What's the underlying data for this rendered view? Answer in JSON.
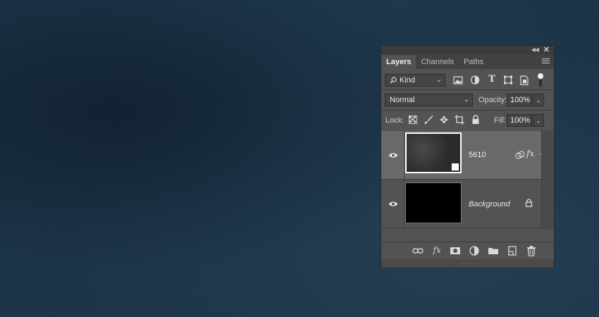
{
  "panel": {
    "tabs": [
      "Layers",
      "Channels",
      "Paths"
    ],
    "filter": {
      "value": "Kind"
    },
    "blend_mode": {
      "value": "Normal"
    },
    "opacity": {
      "label": "Opacity:",
      "value": "100%"
    },
    "lock": {
      "label": "Lock:"
    },
    "fill": {
      "label": "Fill:",
      "value": "100%"
    },
    "layers": [
      {
        "name": "5610",
        "visible": true,
        "selected": true,
        "thumbnail": "dark-texture",
        "smart_object": true,
        "effects": true
      },
      {
        "name": "Background",
        "visible": true,
        "selected": false,
        "thumbnail": "black",
        "locked": true
      }
    ],
    "bottom_icons": [
      "link-layers-icon",
      "fx-icon",
      "add-mask-icon",
      "adjustment-layer-icon",
      "new-group-icon",
      "new-layer-icon",
      "delete-layer-icon"
    ]
  },
  "colors": {
    "canvas_bg": "#1c3449",
    "panel_bg": "#535353",
    "selected_layer_bg": "#696969"
  }
}
